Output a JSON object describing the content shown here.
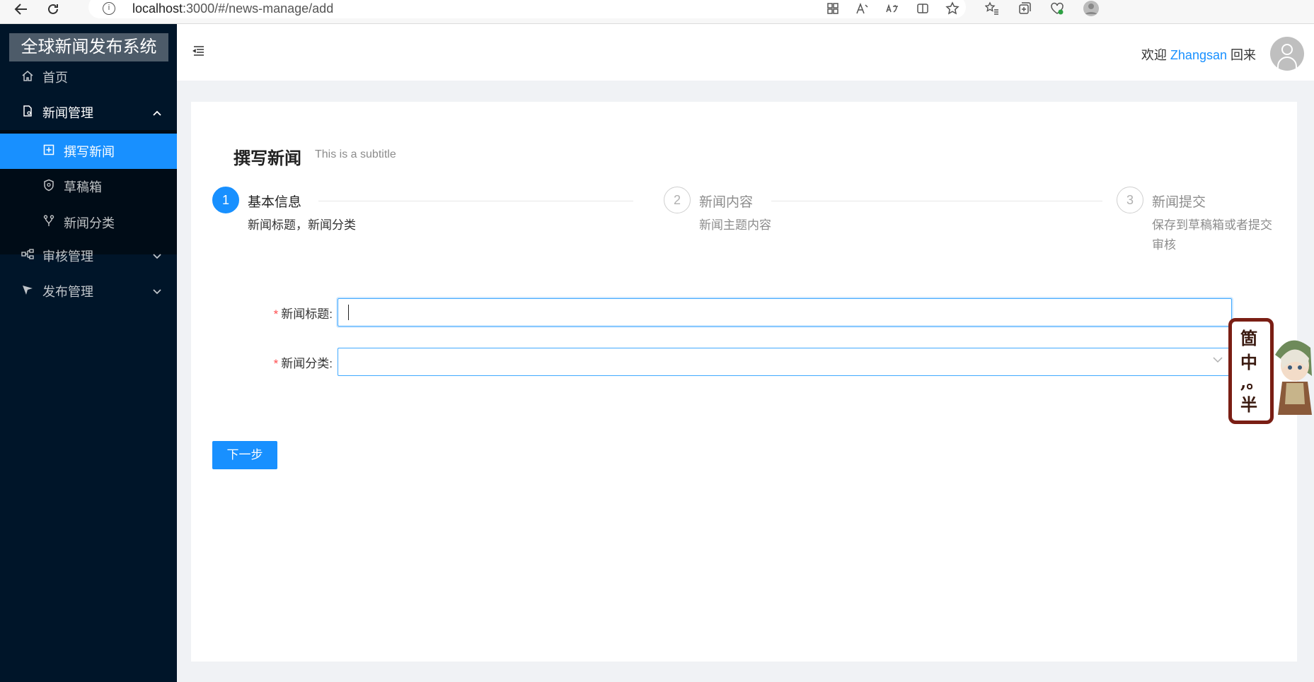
{
  "browser": {
    "url_host": "localhost",
    "url_path": ":3000/#/news-manage/add",
    "info_glyph": "i"
  },
  "sidebar": {
    "logo": "全球新闻发布系统",
    "items": [
      {
        "label": "首页",
        "icon": "home-icon"
      },
      {
        "label": "新闻管理",
        "icon": "file-icon",
        "open": true
      },
      {
        "label": "撰写新闻",
        "icon": "plus-square-icon",
        "active": true
      },
      {
        "label": "草稿箱",
        "icon": "shield-icon"
      },
      {
        "label": "新闻分类",
        "icon": "branch-icon"
      },
      {
        "label": "审核管理",
        "icon": "cluster-icon"
      },
      {
        "label": "发布管理",
        "icon": "send-icon"
      }
    ]
  },
  "header": {
    "welcome_prefix": "欢迎",
    "username": "Zhangsan",
    "welcome_suffix": "回来"
  },
  "page": {
    "title": "撰写新闻",
    "subtitle": "This is a subtitle"
  },
  "steps": [
    {
      "number": "1",
      "title": "基本信息",
      "desc": "新闻标题，新闻分类",
      "status": "process"
    },
    {
      "number": "2",
      "title": "新闻内容",
      "desc": "新闻主题内容",
      "status": "wait"
    },
    {
      "number": "3",
      "title": "新闻提交",
      "desc": "保存到草稿箱或者提交审核",
      "status": "wait"
    }
  ],
  "form": {
    "title_label": "新闻标题:",
    "title_value": "",
    "category_label": "新闻分类:",
    "category_value": "",
    "required_mark": "*"
  },
  "actions": {
    "next_label": "下一步"
  },
  "mascot": {
    "chars": [
      "箇",
      "中",
      ",。",
      "半"
    ]
  },
  "colors": {
    "primary": "#1890ff",
    "sidebar_bg": "#001529",
    "required": "#ff4d4f"
  }
}
